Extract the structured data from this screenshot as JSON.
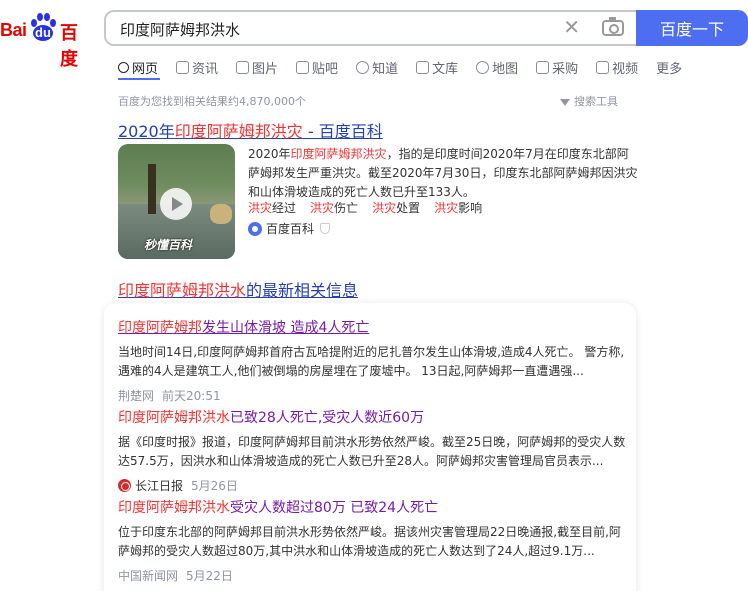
{
  "header": {
    "logo_bai": "Bai",
    "logo_du": "du",
    "logo_cn": "百度",
    "query": "印度阿萨姆邦洪水",
    "search_button": "百度一下",
    "icons": [
      "clear-icon",
      "camera-icon"
    ]
  },
  "tabs": [
    {
      "label": "网页",
      "icon": "search-icon",
      "active": true
    },
    {
      "label": "资讯",
      "icon": "news-icon"
    },
    {
      "label": "图片",
      "icon": "image-icon"
    },
    {
      "label": "贴吧",
      "icon": "tieba-icon"
    },
    {
      "label": "知道",
      "icon": "question-icon"
    },
    {
      "label": "文库",
      "icon": "doc-icon"
    },
    {
      "label": "地图",
      "icon": "map-icon"
    },
    {
      "label": "采购",
      "icon": "cart-icon"
    },
    {
      "label": "视频",
      "icon": "video-icon"
    },
    {
      "label": "更多"
    }
  ],
  "result_info": "百度为您找到相关结果约4,870,000个",
  "search_tools": "搜索工具",
  "result1": {
    "title_prefix": "2020年",
    "title_em": "印度阿萨姆邦洪灾",
    "title_suffix": " - 百度百科",
    "thumb_watermark": "秒懂百科",
    "abstract_1": "2020年",
    "abstract_em": "印度阿萨姆邦洪灾",
    "abstract_2": "，指的是印度时间2020年7月在印度东北部阿萨姆邦发生严重洪灾。截至2020年7月30日，印度东北部阿萨姆邦因洪灾和山体滑坡造成的死亡人数已升至133人。",
    "links": [
      {
        "em": "洪灾",
        "rest": "经过"
      },
      {
        "em": "洪灾",
        "rest": "伤亡"
      },
      {
        "em": "洪灾",
        "rest": "处置"
      },
      {
        "em": "洪灾",
        "rest": "影响"
      }
    ],
    "source": "百度百科"
  },
  "news": {
    "head_em": "印度阿萨姆邦洪水",
    "head_rest": "的最新相关信息",
    "items": [
      {
        "title_em": "印度阿萨姆邦",
        "title_rest": "发生山体滑坡 造成4人死亡",
        "desc": "当地时间14日,印度阿萨姆邦首府古瓦哈提附近的尼扎普尔发生山体滑坡,造成4人死亡。 警方称,遇难的4人是建筑工人,他们被倒塌的房屋埋在了废墟中。 13日起,阿萨姆邦一直遭遇强...",
        "source": "荆楚网",
        "time": "前天20:51"
      },
      {
        "title_em": "印度阿萨姆邦洪水",
        "title_rest": "已致28人死亡,受灾人数近60万",
        "desc": "据《印度时报》报道，印度阿萨姆邦目前洪水形势依然严峻。截至25日晚，阿萨姆邦的受灾人数达57.5万，因洪水和山体滑坡造成的死亡人数已升至28人。阿萨姆邦灾害管理局官员表示...",
        "source": "长江日报",
        "time": "5月26日"
      },
      {
        "title_em": "印度阿萨姆邦洪水",
        "title_rest": "受灾人数超过80万 已致24人死亡",
        "desc": "位于印度东北部的阿萨姆邦目前洪水形势依然严峻。据该州灾害管理局22日晚通报,截至目前,阿萨姆邦的受灾人数超过80万,其中洪水和山体滑坡造成的死亡人数达到了24人,超过9.1万...",
        "source": "中国新闻网",
        "time": "5月22日"
      }
    ]
  }
}
